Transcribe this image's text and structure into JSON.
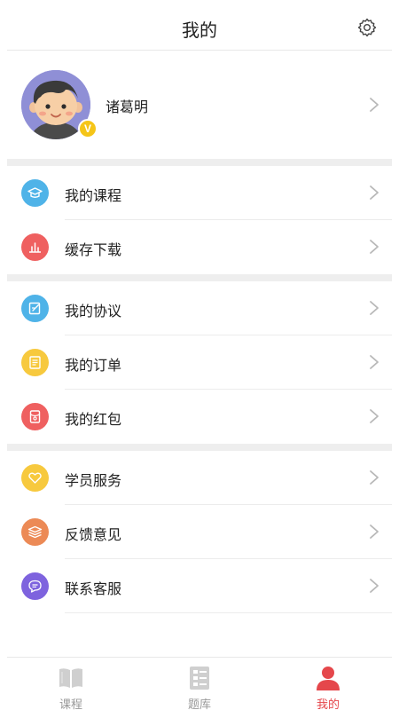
{
  "header": {
    "title": "我的"
  },
  "profile": {
    "name": "诸葛明",
    "badge": "V"
  },
  "groups": [
    {
      "items": [
        {
          "key": "courses",
          "label": "我的课程",
          "icon": "graduation-cap-icon",
          "color": "#4fb3e8"
        },
        {
          "key": "downloads",
          "label": "缓存下载",
          "icon": "download-chart-icon",
          "color": "#ef6060"
        }
      ]
    },
    {
      "items": [
        {
          "key": "agreement",
          "label": "我的协议",
          "icon": "edit-document-icon",
          "color": "#4fb3e8"
        },
        {
          "key": "orders",
          "label": "我的订单",
          "icon": "order-list-icon",
          "color": "#f7c93e"
        },
        {
          "key": "redpacket",
          "label": "我的红包",
          "icon": "red-packet-icon",
          "color": "#ef6060"
        }
      ]
    },
    {
      "items": [
        {
          "key": "service",
          "label": "学员服务",
          "icon": "heart-service-icon",
          "color": "#f7c93e"
        },
        {
          "key": "feedback",
          "label": "反馈意见",
          "icon": "stack-feedback-icon",
          "color": "#ec8a56"
        },
        {
          "key": "contact",
          "label": "联系客服",
          "icon": "chat-bubble-icon",
          "color": "#7e63de"
        }
      ]
    }
  ],
  "tabs": [
    {
      "label": "课程",
      "icon": "book-icon",
      "active": false
    },
    {
      "label": "题库",
      "icon": "question-bank-icon",
      "active": false
    },
    {
      "label": "我的",
      "icon": "person-icon",
      "active": true
    }
  ],
  "colors": {
    "active": "#e5474b",
    "inactive": "#cfcfcf",
    "divider": "#eeeeee"
  }
}
